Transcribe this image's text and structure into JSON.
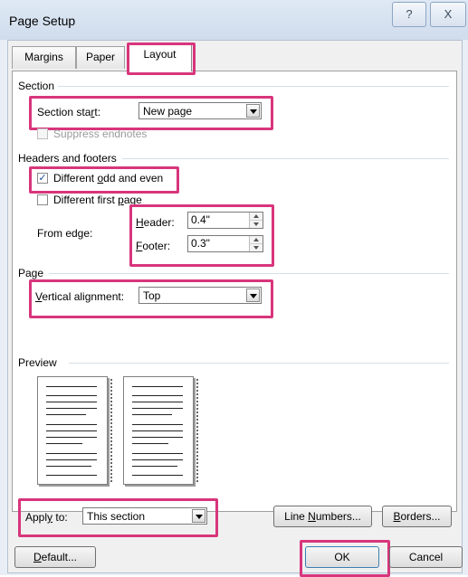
{
  "window": {
    "title": "Page Setup",
    "help_glyph": "?",
    "close_glyph": "X"
  },
  "tabs": [
    {
      "label": "Margins"
    },
    {
      "label": "Paper"
    },
    {
      "label": "Layout"
    }
  ],
  "section": {
    "group_title": "Section",
    "start_label_pre": "Section sta",
    "start_label_u": "r",
    "start_label_post": "t:",
    "start_value": "New page",
    "suppress_label": "Suppress endnotes"
  },
  "headers_footers": {
    "group_title": "Headers and footers",
    "odd_even_pre": "Different ",
    "odd_even_u": "o",
    "odd_even_post": "dd and even",
    "first_page_pre": "Different first ",
    "first_page_u": "p",
    "first_page_post": "age",
    "from_edge_label": "From edge:",
    "header_label_u": "H",
    "header_label_post": "eader:",
    "header_value": "0.4\"",
    "footer_label_u": "F",
    "footer_label_post": "ooter:",
    "footer_value": "0.3\""
  },
  "page": {
    "group_title": "Page",
    "valign_label_u": "V",
    "valign_label_post": "ertical alignment:",
    "valign_value": "Top"
  },
  "preview": {
    "group_title": "Preview"
  },
  "apply": {
    "label_pre": "Appl",
    "label_u": "y",
    "label_post": " to:",
    "value": "This section"
  },
  "buttons": {
    "line_numbers_pre": "Line ",
    "line_numbers_u": "N",
    "line_numbers_post": "umbers...",
    "borders_u": "B",
    "borders_post": "orders...",
    "default_u": "D",
    "default_post": "efault...",
    "ok": "OK",
    "cancel": "Cancel"
  },
  "colors": {
    "highlight": "#d8357c",
    "titlebar": "#cfdcec"
  }
}
